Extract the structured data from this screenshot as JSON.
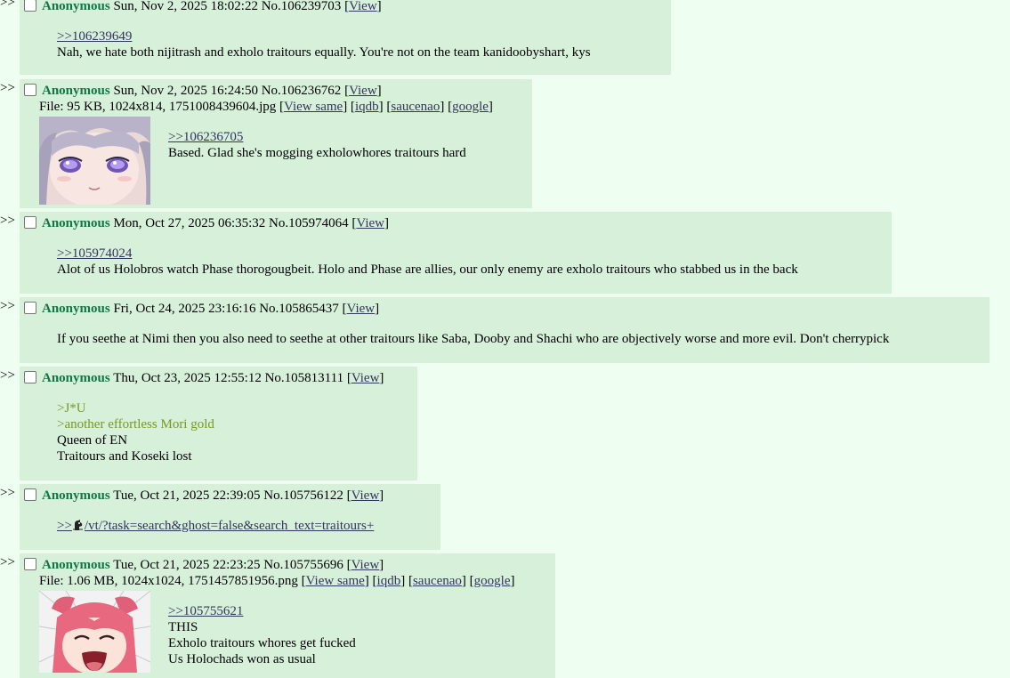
{
  "arrow": ">>",
  "view": "View",
  "view_same": "View same",
  "iqdb": "iqdb",
  "saucenao": "saucenao",
  "google": "google",
  "posts": [
    {
      "name": "Anonymous",
      "date": "Sun, Nov 2, 2025 18:02:22",
      "no": "No.106239703",
      "lines": [
        ">>106239649",
        "Nah, we hate both nijitrash and exholo traitours equally. You're not on the team kanidoobyshart, kys"
      ]
    },
    {
      "name": "Anonymous",
      "date": "Sun, Nov 2, 2025 16:24:50",
      "no": "No.106236762",
      "file": "File: 95 KB, 1024x814, 1751008439604.jpg",
      "thumb_icon": "lavender-haired-anime-girl-thumbnail",
      "lines": [
        ">>106236705",
        "Based. Glad she's mogging exholowhores traitours hard"
      ]
    },
    {
      "name": "Anonymous",
      "date": "Mon, Oct 27, 2025 06:35:32",
      "no": "No.105974064",
      "lines": [
        ">>105974024",
        "Alot of us Holobros watch Phase thorogougbeit. Holo and Phase are allies, our only enemy are exholo traitours who stabbed us in the back"
      ]
    },
    {
      "name": "Anonymous",
      "date": "Fri, Oct 24, 2025 23:16:16",
      "no": "No.105865437",
      "lines": [
        "If you seethe at Nimi then you also need to seethe at other traitours like Saba, Dooby and Shachi who are objectively worse and more evil. Don't cherrypick"
      ]
    },
    {
      "name": "Anonymous",
      "date": "Thu, Oct 23, 2025 12:55:12",
      "no": "No.105813111",
      "lines": [
        ">J*U",
        ">another effortless Mori gold",
        "Queen of EN",
        "Traitours and Koseki lost"
      ]
    },
    {
      "name": "Anonymous",
      "date": "Tue, Oct 21, 2025 22:39:05",
      "no": "No.105756122",
      "link_prefix": ">>",
      "link_path": "/vt/?task=search&ghost=false&search_text=traitours+"
    },
    {
      "name": "Anonymous",
      "date": "Tue, Oct 21, 2025 22:23:25",
      "no": "No.105755696",
      "file": "File: 1.06 MB, 1024x1024, 1751457851956.png",
      "thumb_icon": "pink-haired-anime-girl-thumbnail",
      "lines": [
        ">>105755621",
        "THIS",
        "Exholo traitours whores get fucked",
        "Us Holochads won as usual"
      ]
    }
  ]
}
